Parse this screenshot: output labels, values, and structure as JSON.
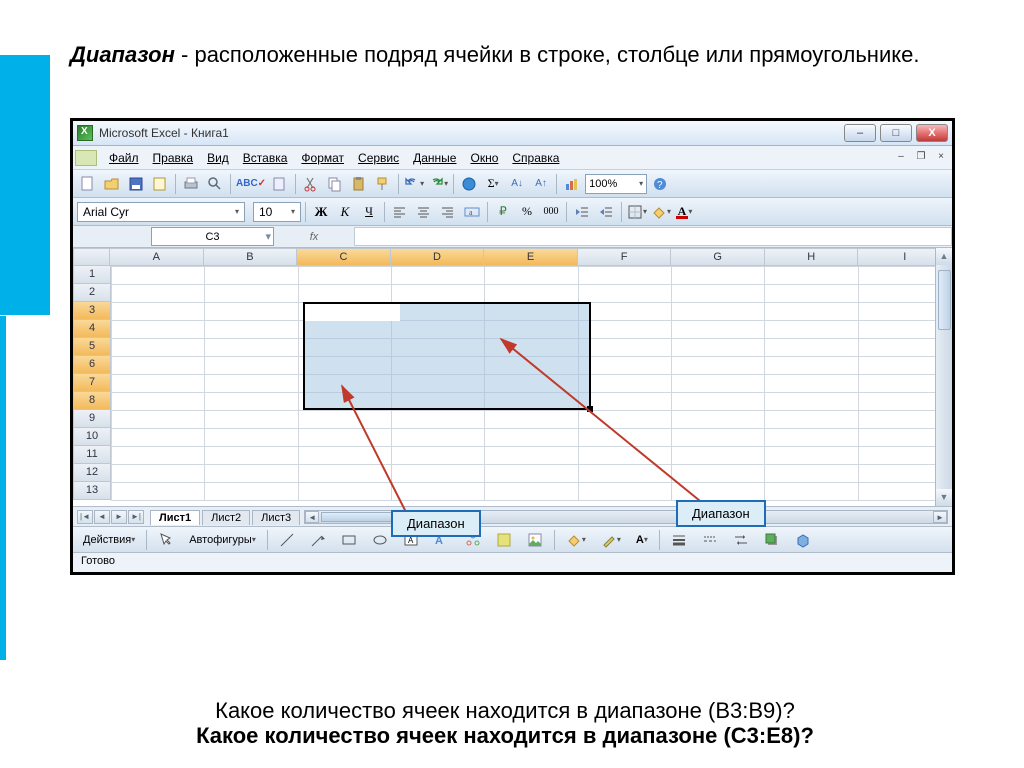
{
  "heading": {
    "term": "Диапазон",
    "rest": " - расположенные подряд ячейки в строке, столбце или прямоугольнике."
  },
  "window": {
    "title": "Microsoft Excel - Книга1",
    "min": "–",
    "max": "□",
    "close": "X"
  },
  "menu": {
    "file": "Файл",
    "edit": "Правка",
    "view": "Вид",
    "insert": "Вставка",
    "format": "Формат",
    "service": "Сервис",
    "data": "Данные",
    "windowm": "Окно",
    "help": "Справка",
    "doc_min": "–",
    "doc_max": "❐",
    "doc_close": "×"
  },
  "fontbar": {
    "font_name": "Arial Cyr",
    "font_size": "10",
    "bold": "Ж",
    "italic": "К",
    "underline": "Ч"
  },
  "toolbar": {
    "zoom": "100%",
    "sigma": "Σ",
    "currency": "₽",
    "percent": "%"
  },
  "namebox": {
    "ref": "C3",
    "fx_label": "fx"
  },
  "columns": [
    "A",
    "B",
    "C",
    "D",
    "E",
    "F",
    "G",
    "H",
    "I"
  ],
  "rows": [
    "1",
    "2",
    "3",
    "4",
    "5",
    "6",
    "7",
    "8",
    "9",
    "10",
    "11",
    "12",
    "13"
  ],
  "sel_cols": [
    "C",
    "D",
    "E"
  ],
  "sel_rows": [
    "3",
    "4",
    "5",
    "6",
    "7",
    "8"
  ],
  "tabs": {
    "t1": "Лист1",
    "t2": "Лист2",
    "t3": "Лист3"
  },
  "drawbar": {
    "actions": "Действия",
    "autoshapes": "Автофигуры"
  },
  "status": {
    "ready": "Готово"
  },
  "callouts": {
    "c1": "Диапазон",
    "c2": "Диапазон"
  },
  "bottom": {
    "l1_a": "Какое количество ячеек находится в диапазоне (",
    "l1_b": "B3:B9",
    "l1_c": ")?",
    "l2_a": "Какое количество ячеек находится в диапазоне (",
    "l2_b": "C3:E8",
    "l2_c": ")?"
  }
}
